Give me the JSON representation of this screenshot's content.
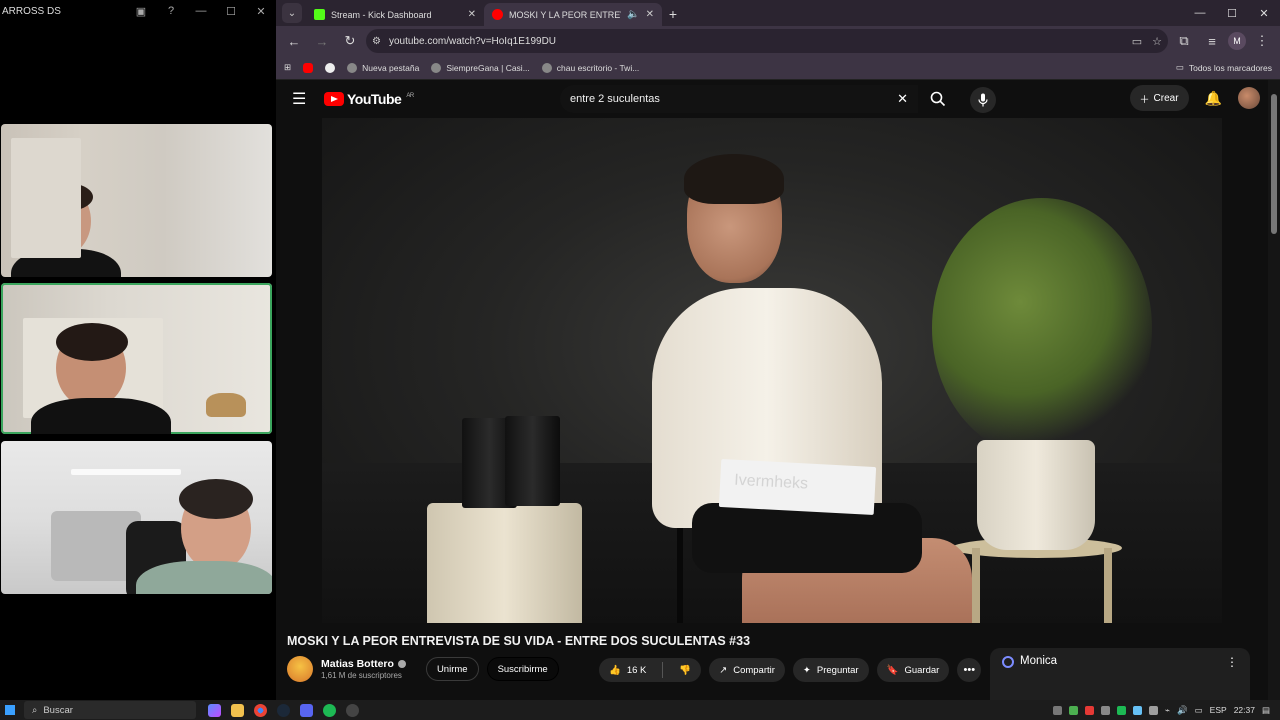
{
  "discord": {
    "title": "ARROSS DS",
    "controls": [
      "—",
      "☐",
      "✕"
    ]
  },
  "browser": {
    "tabs": [
      {
        "title": "Stream - Kick Dashboard",
        "favicon_color": "#53fc18"
      },
      {
        "title": "MOSKI Y LA PEOR ENTREVI",
        "favicon_color": "#ff0000"
      }
    ],
    "new_tab": "+",
    "window_controls": [
      "—",
      "☐",
      "✕"
    ],
    "url": "youtube.com/watch?v=HoIq1E199DU",
    "bookmarks": [
      {
        "label": "",
        "color": "#ff0000"
      },
      {
        "label": "",
        "color": "#ffffff"
      },
      {
        "label": "Nueva pestaña",
        "color": "#bbbbbb"
      },
      {
        "label": "SiempreGana | Casi...",
        "color": "#bbbbbb"
      },
      {
        "label": "chau escritorio - Twi...",
        "color": "#bbbbbb"
      }
    ],
    "bookmarks_right": "Todos los marcadores",
    "profile_initial": "M"
  },
  "youtube": {
    "logo_text": "YouTube",
    "region": "AR",
    "search_value": "entre 2 suculentas",
    "create_label": "Crear",
    "video_title": "MOSKI Y LA PEOR ENTREVISTA DE SU VIDA - ENTRE DOS SUCULENTAS #33",
    "channel_name": "Matias Bottero",
    "subscribers": "1,61 M de suscriptores",
    "join_label": "Unirme",
    "subscribe_label": "Suscribirme",
    "likes": "16 K",
    "share_label": "Compartir",
    "ask_label": "Preguntar",
    "save_label": "Guardar",
    "paper_text": "Ivermheks"
  },
  "monica": {
    "label": "Monica"
  },
  "taskbar": {
    "search_placeholder": "Buscar",
    "lang": "ESP",
    "time": "22:37"
  }
}
